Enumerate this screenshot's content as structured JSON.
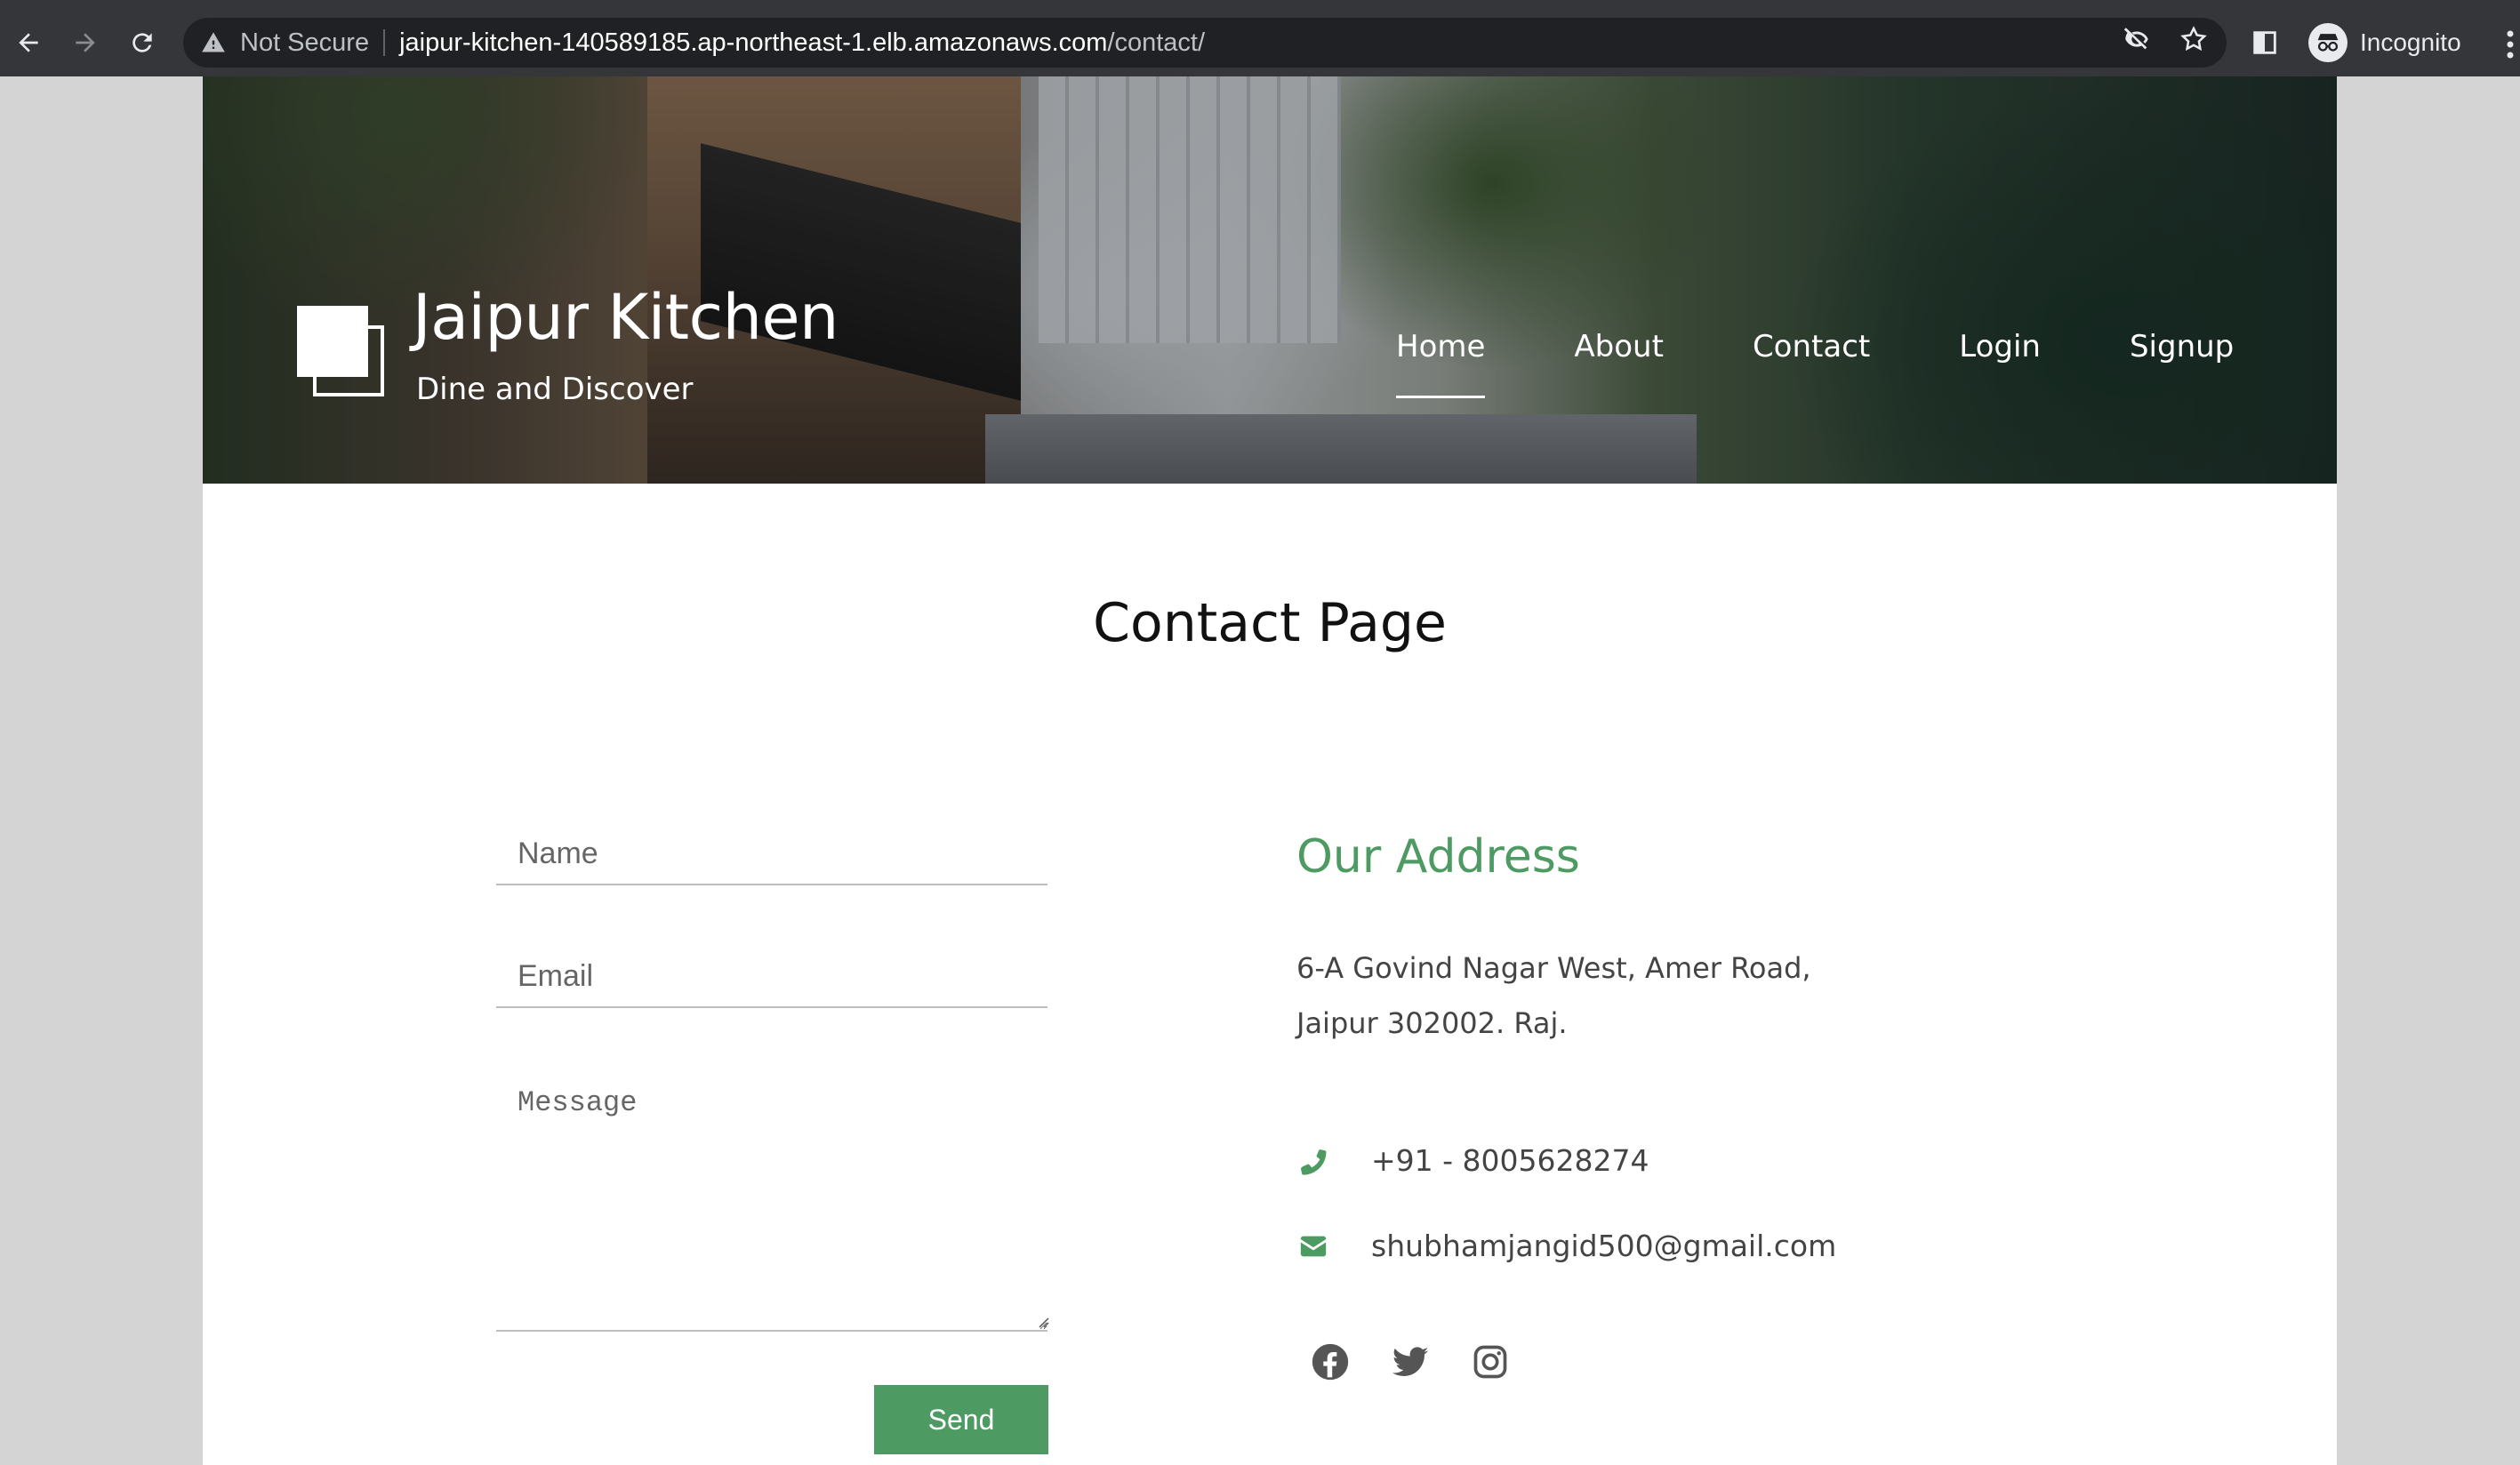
{
  "browser": {
    "security_label": "Not Secure",
    "url_host": "jaipur-kitchen-140589185.ap-northeast-1.elb.amazonaws.com",
    "url_path": "/contact/",
    "profile_label": "Incognito"
  },
  "site": {
    "title": "Jaipur Kitchen",
    "tagline": "Dine and Discover",
    "nav": [
      {
        "label": "Home",
        "active": true
      },
      {
        "label": "About"
      },
      {
        "label": "Contact"
      },
      {
        "label": "Login"
      },
      {
        "label": "Signup"
      }
    ]
  },
  "main": {
    "page_title": "Contact Page",
    "form": {
      "name_placeholder": "Name",
      "email_placeholder": "Email",
      "message_placeholder": "Message",
      "send_label": "Send"
    },
    "address": {
      "heading": "Our Address",
      "line1": "6-A Govind Nagar West, Amer Road,",
      "line2": "Jaipur 302002. Raj.",
      "phone": "+91 - 8005628274",
      "email": "shubhamjangid500@gmail.com"
    },
    "social": [
      "facebook-icon",
      "twitter-icon",
      "instagram-icon"
    ]
  },
  "colors": {
    "accent": "#4e9a63",
    "chrome_bg": "#35363a",
    "omnibox_bg": "#202124"
  }
}
